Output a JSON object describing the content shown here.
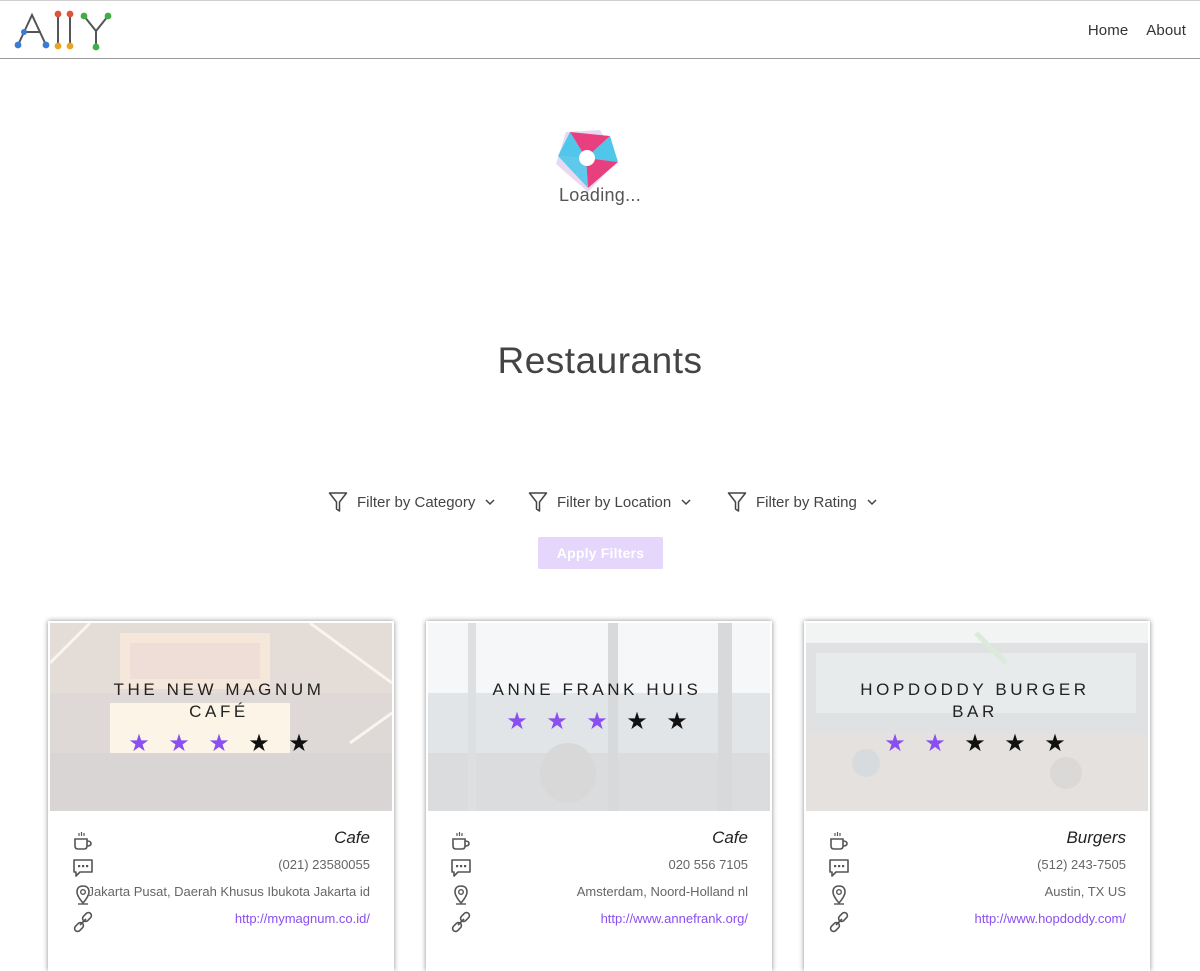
{
  "nav": {
    "home": "Home",
    "about": "About"
  },
  "loading": {
    "text": "Loading..."
  },
  "page": {
    "title": "Restaurants"
  },
  "filters": {
    "category": "Filter by Category",
    "location": "Filter by Location",
    "rating": "Filter by Rating",
    "apply": "Apply Filters"
  },
  "colors": {
    "accent": "#8a4ff0",
    "apply_bg": "#e4d7fb"
  },
  "restaurants": [
    {
      "name": "The New Magnum Café",
      "rating": 3,
      "category": "Cafe",
      "phone": "(021) 23580055",
      "location": "Jakarta Pusat, Daerah Khusus Ibukota Jakarta id",
      "url": "http://mymagnum.co.id/"
    },
    {
      "name": "Anne Frank Huis",
      "rating": 3,
      "category": "Cafe",
      "phone": "020 556 7105",
      "location": "Amsterdam, Noord-Holland nl",
      "url": "http://www.annefrank.org/"
    },
    {
      "name": "Hopdoddy Burger Bar",
      "rating": 2,
      "category": "Burgers",
      "phone": "(512) 243-7505",
      "location": "Austin, TX US",
      "url": "http://www.hopdoddy.com/"
    }
  ],
  "icons": [
    "coffee-cup-icon",
    "chat-bubble-icon",
    "map-pin-icon",
    "link-icon",
    "funnel-icon",
    "chevron-down-icon"
  ]
}
